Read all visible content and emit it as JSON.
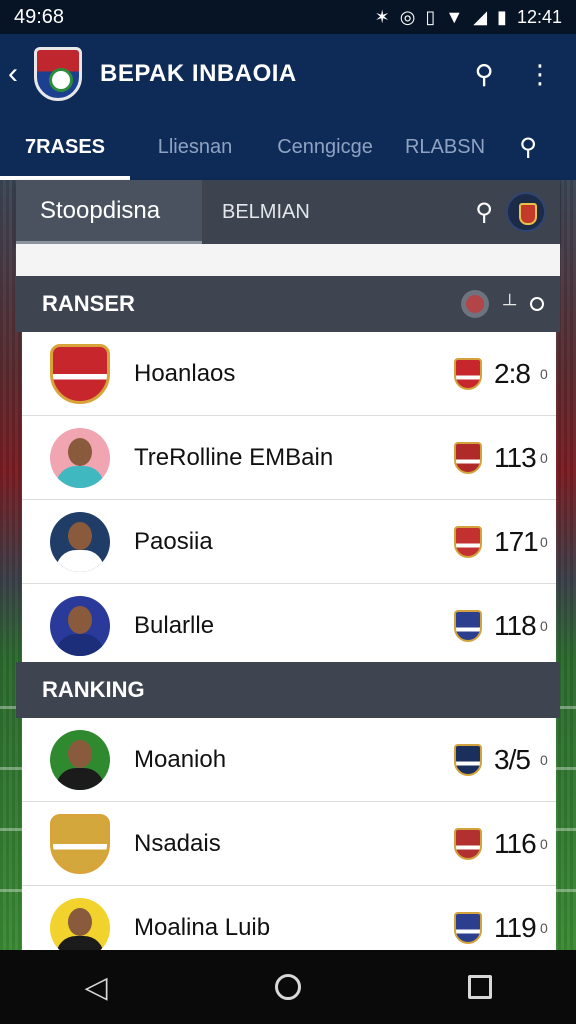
{
  "status_bar": {
    "left_time": "49:68",
    "right_time": "12:41",
    "icons": [
      "bluetooth-icon",
      "nfc-icon",
      "vibrate-icon",
      "wifi-icon",
      "signal-icon",
      "battery-icon"
    ]
  },
  "app_bar": {
    "title": "BEPAK INBAOIA",
    "icons": [
      "back-arrow-icon",
      "search-icon",
      "more-vert-icon"
    ]
  },
  "tabs": [
    {
      "label": "7RASES",
      "active": true
    },
    {
      "label": "Lliesnan",
      "active": false
    },
    {
      "label": "Cenngicge",
      "active": false
    },
    {
      "label": "RLABSN",
      "active": false
    }
  ],
  "filter_bar": {
    "primary": "Stoopdisna",
    "secondary": "BELMIAN"
  },
  "sections": [
    {
      "title": "RANSER",
      "rows": [
        {
          "name": "Hoanlaos",
          "score": "2:8",
          "suffix": "0",
          "avatar": "crest",
          "color": "#c8262d",
          "mini_color": "#c8262d"
        },
        {
          "name": "TreRolline EMBain",
          "score": "113",
          "suffix": "0",
          "avatar": "person",
          "color": "#f0a5b0",
          "shirt": "#3fb8c0",
          "mini_color": "#b02a2a"
        },
        {
          "name": "Paosiia",
          "score": "171",
          "suffix": "0",
          "avatar": "person",
          "color": "#1f3d66",
          "shirt": "#ffffff",
          "mini_color": "#c23030"
        },
        {
          "name": "Bularlle",
          "score": "118",
          "suffix": "0",
          "avatar": "person",
          "color": "#2a3a9a",
          "shirt": "#1c2d7a",
          "mini_color": "#2c3f8f"
        }
      ]
    },
    {
      "title": "RANKING",
      "rows": [
        {
          "name": "Moanioh",
          "score": "3/5",
          "suffix": "0",
          "avatar": "person",
          "color": "#2f8a2f",
          "shirt": "#1b1b1b",
          "mini_color": "#1a2f5c"
        },
        {
          "name": "Nsadais",
          "score": "116",
          "suffix": "0",
          "avatar": "crest",
          "color": "#d3a73c",
          "mini_color": "#b23030"
        },
        {
          "name": "Moalina Luib",
          "score": "119",
          "suffix": "0",
          "avatar": "person",
          "color": "#f2d22c",
          "shirt": "#1b1b1b",
          "mini_color": "#2c3f8f"
        }
      ]
    }
  ],
  "nav_bar": [
    "back-triangle-icon",
    "home-circle-icon",
    "recents-square-icon"
  ]
}
